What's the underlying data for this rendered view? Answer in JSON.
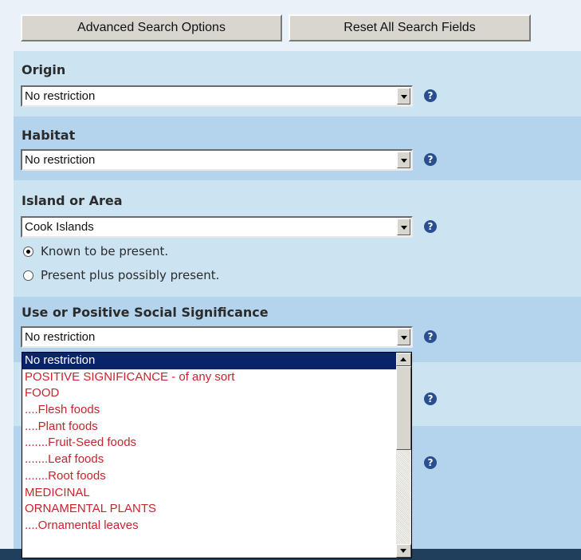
{
  "toolbar": {
    "advanced_label": "Advanced Search Options",
    "reset_label": "Reset All Search Fields"
  },
  "fields": {
    "origin": {
      "label": "Origin",
      "value": "No restriction"
    },
    "habitat": {
      "label": "Habitat",
      "value": "No restriction"
    },
    "island": {
      "label": "Island or Area",
      "value": "Cook Islands",
      "radio_known": "Known to be present.",
      "radio_possible": "Present plus possibly present."
    },
    "use": {
      "label": "Use or Positive Social Significance",
      "value": "No restriction"
    }
  },
  "help_glyph": "?",
  "dropdown": {
    "options": [
      "No restriction",
      "POSITIVE SIGNIFICANCE - of any sort",
      "FOOD",
      "....Flesh foods",
      "....Plant foods",
      ".......Fruit-Seed foods",
      ".......Leaf foods",
      ".......Root foods",
      "MEDICINAL",
      "ORNAMENTAL PLANTS",
      "....Ornamental leaves"
    ]
  },
  "colors": {
    "band_light": "#cce3f2",
    "band_dark": "#b3d4ec",
    "option_text": "#c4262c",
    "selected_bg": "#0a246a",
    "help_icon": "#2a4f8f"
  }
}
